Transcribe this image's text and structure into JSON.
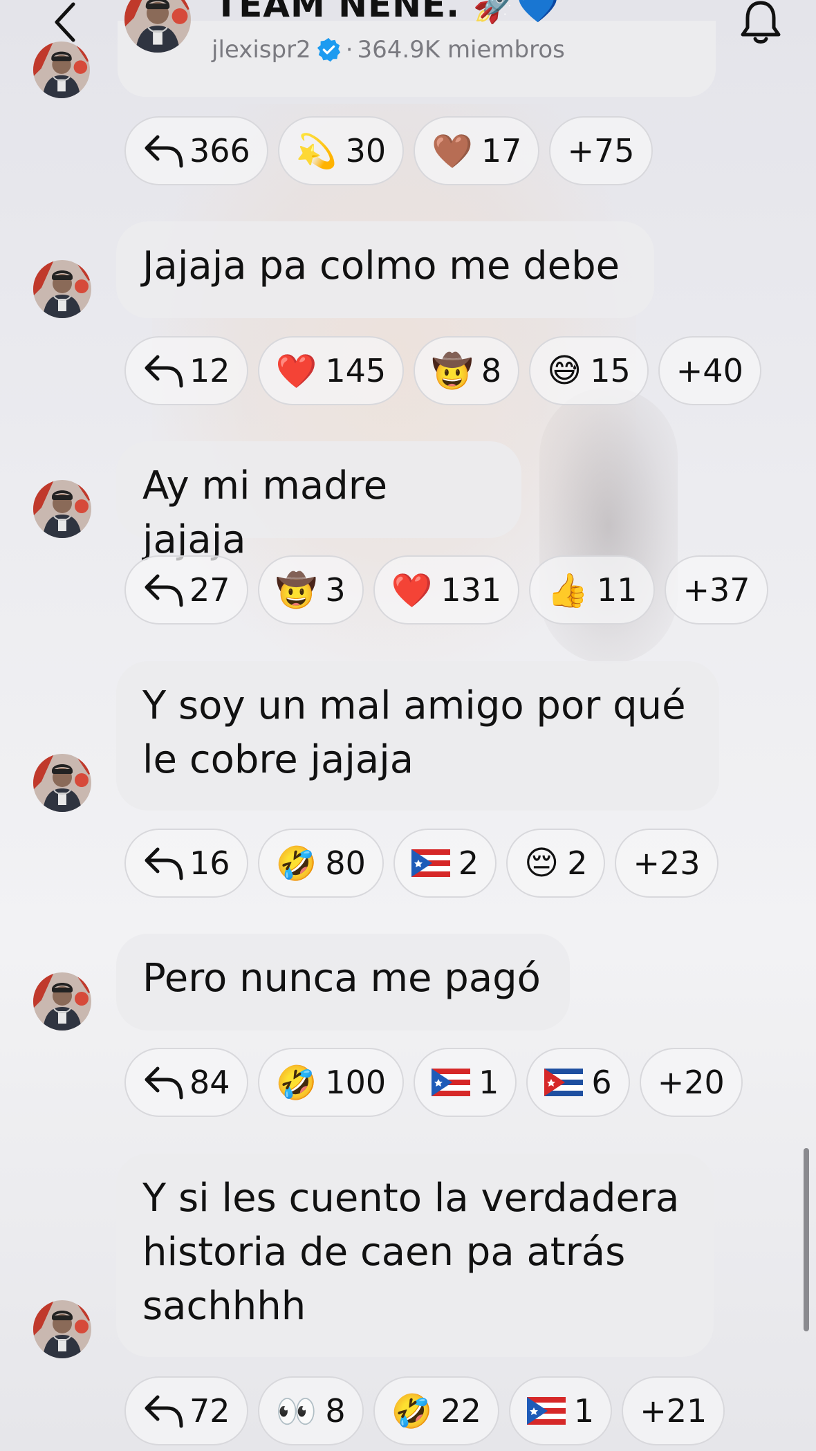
{
  "header": {
    "title": "TEAM NENE. 🚀💙",
    "username": "jlexispr2",
    "separator": "·",
    "members": "364.9K miembros",
    "back_icon": "chevron-left-icon",
    "bell_icon": "bell-icon"
  },
  "colors": {
    "verified": "#1d9bf0",
    "bubble": "#ececee",
    "text": "#111111",
    "subtext": "#7a7a80"
  },
  "previous_reactions": [
    {
      "kind": "reply",
      "count": "366"
    },
    {
      "kind": "emoji",
      "emoji": "💫",
      "count": "30"
    },
    {
      "kind": "emoji",
      "emoji": "🤎",
      "count": "17"
    },
    {
      "kind": "more",
      "count": "+75"
    }
  ],
  "messages": [
    {
      "text": "Jajaja pa colmo me debe",
      "reactions": [
        {
          "kind": "reply",
          "count": "12"
        },
        {
          "kind": "emoji",
          "emoji": "❤️",
          "count": "145"
        },
        {
          "kind": "emoji",
          "emoji": "🤠",
          "count": "8"
        },
        {
          "kind": "emoji",
          "emoji": "😅",
          "count": "15"
        },
        {
          "kind": "more",
          "count": "+40"
        }
      ]
    },
    {
      "text": "Ay mi madre jajaja",
      "reactions": [
        {
          "kind": "reply",
          "count": "27"
        },
        {
          "kind": "emoji",
          "emoji": "🤠",
          "count": "3"
        },
        {
          "kind": "emoji",
          "emoji": "❤️",
          "count": "131"
        },
        {
          "kind": "emoji",
          "emoji": "👍",
          "count": "11"
        },
        {
          "kind": "more",
          "count": "+37"
        }
      ]
    },
    {
      "text": "Y soy un mal amigo por qué\nle cobre jajaja",
      "reactions": [
        {
          "kind": "reply",
          "count": "16"
        },
        {
          "kind": "emoji",
          "emoji": "🤣",
          "count": "80"
        },
        {
          "kind": "flag",
          "flag": "puerto-rico-flag",
          "count": "2"
        },
        {
          "kind": "emoji",
          "emoji": "😔",
          "count": "2"
        },
        {
          "kind": "more",
          "count": "+23"
        }
      ]
    },
    {
      "text": "Pero nunca me pagó",
      "reactions": [
        {
          "kind": "reply",
          "count": "84"
        },
        {
          "kind": "emoji",
          "emoji": "🤣",
          "count": "100"
        },
        {
          "kind": "flag",
          "flag": "puerto-rico-flag",
          "count": "1"
        },
        {
          "kind": "flag",
          "flag": "cuba-flag",
          "count": "6"
        },
        {
          "kind": "more",
          "count": "+20"
        }
      ]
    },
    {
      "text": "Y si les cuento la verdadera\nhistoria de caen pa atrás\nsachhhh",
      "reactions": [
        {
          "kind": "reply",
          "count": "72"
        },
        {
          "kind": "emoji",
          "emoji": "👀",
          "count": "8"
        },
        {
          "kind": "emoji",
          "emoji": "🤣",
          "count": "22"
        },
        {
          "kind": "flag",
          "flag": "puerto-rico-flag",
          "count": "1"
        },
        {
          "kind": "more",
          "count": "+21"
        }
      ]
    }
  ]
}
